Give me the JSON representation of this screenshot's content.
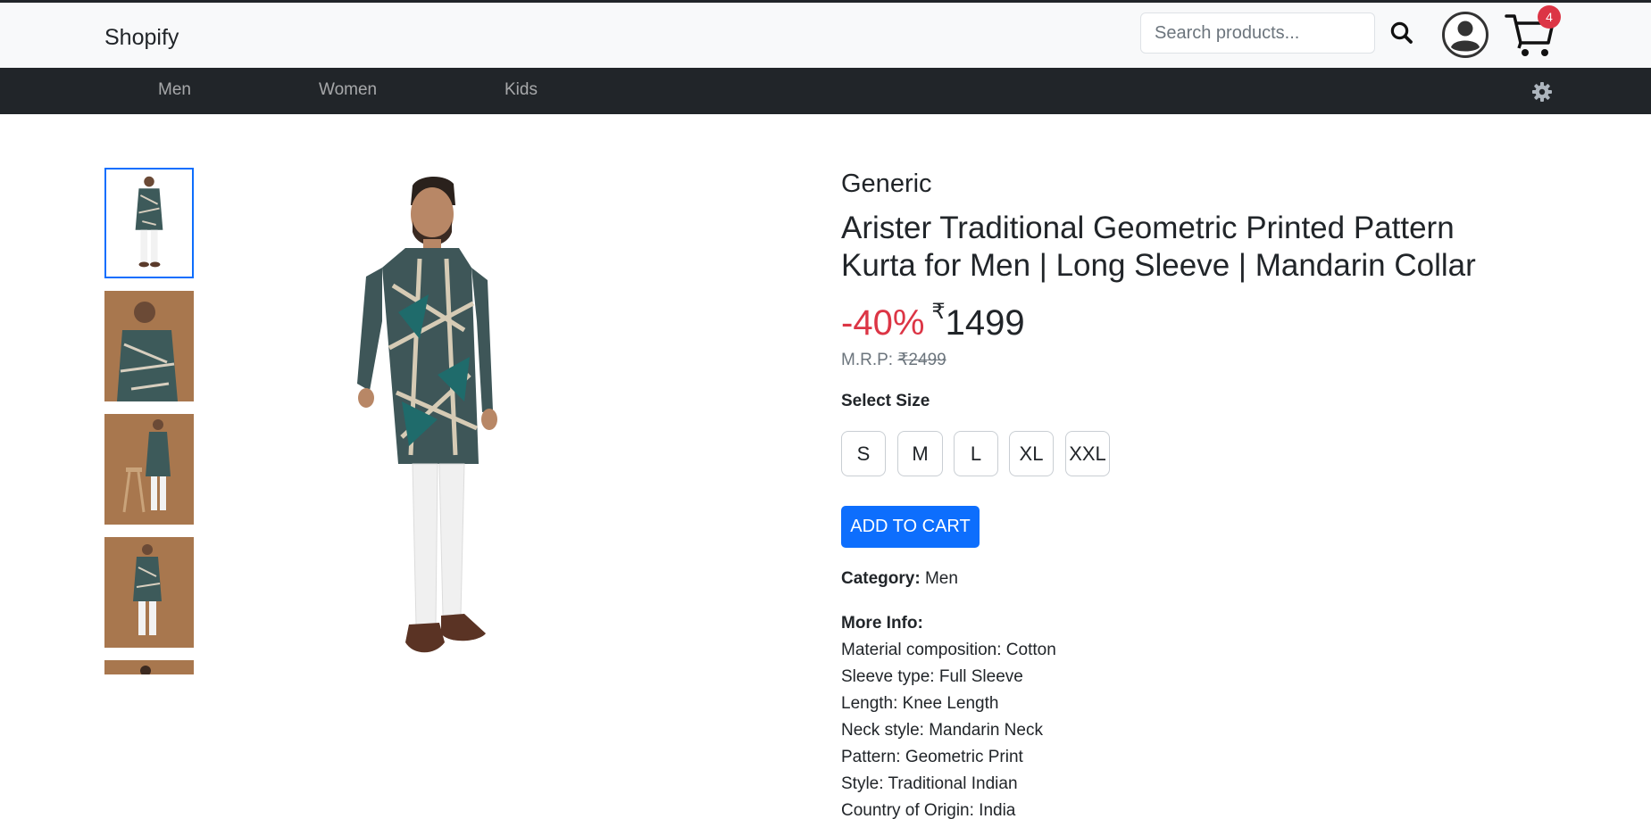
{
  "header": {
    "brand": "Shopify",
    "search_placeholder": "Search products...",
    "cart_count": "4"
  },
  "nav": {
    "items": [
      "Men",
      "Women",
      "Kids"
    ]
  },
  "product": {
    "brand": "Generic",
    "title": "Arister Traditional Geometric Printed Pattern Kurta for Men | Long Sleeve | Mandarin Collar",
    "discount": "-40%",
    "currency": "₹",
    "price": "1499",
    "mrp_label": "M.R.P: ",
    "mrp_value": "₹2499",
    "select_size_label": "Select Size",
    "sizes": [
      "S",
      "M",
      "L",
      "XL",
      "XXL"
    ],
    "add_to_cart": "ADD TO CART",
    "category_label": "Category:",
    "category": "Men",
    "more_info_label": "More Info:",
    "more_info": [
      "Material composition: Cotton",
      "Sleeve type: Full Sleeve",
      "Length: Knee Length",
      "Neck style: Mandarin Neck",
      "Pattern: Geometric Print",
      "Style: Traditional Indian",
      "Country of Origin: India"
    ]
  },
  "colors": {
    "accent": "#0d6efd",
    "discount": "#dc3545",
    "navbar": "#212529",
    "badge": "#dc3545"
  },
  "icons": {
    "search": "search-icon",
    "profile": "user-circle-icon",
    "cart": "cart-icon",
    "settings": "gear-icon"
  }
}
